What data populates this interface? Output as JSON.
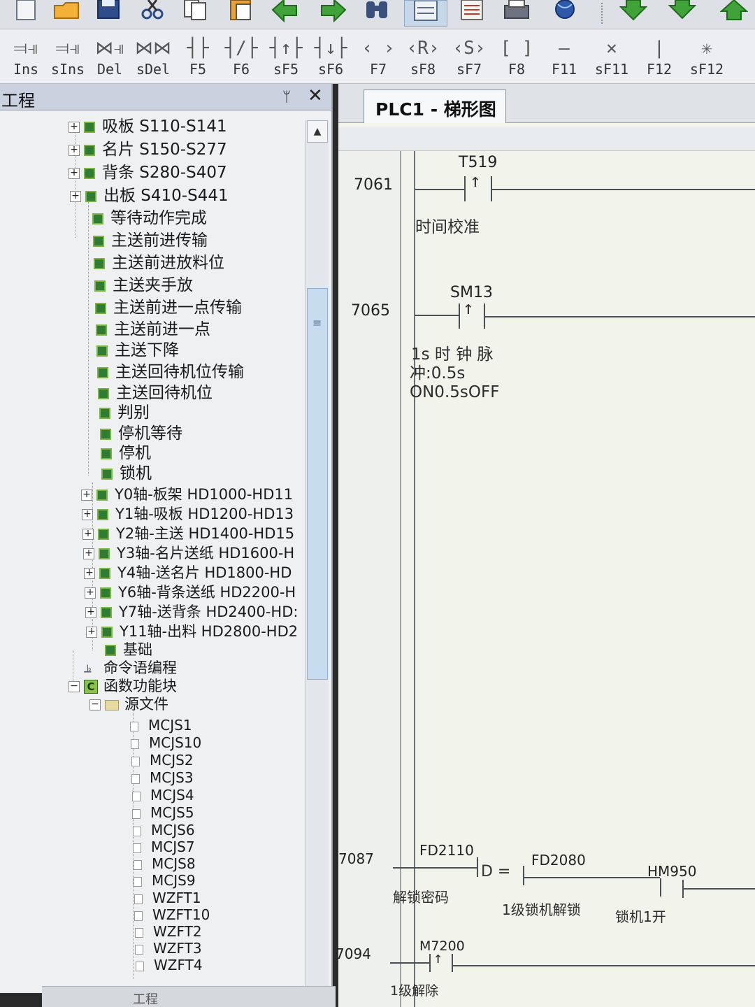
{
  "toolbar_keys": [
    {
      "sym": "⫤⫣",
      "key": "Ins"
    },
    {
      "sym": "⫤⫣",
      "key": "sIns"
    },
    {
      "sym": "⋈⫣",
      "key": "Del"
    },
    {
      "sym": "⋈⋈",
      "key": "sDel"
    },
    {
      "sym": "┤├",
      "key": "F5"
    },
    {
      "sym": "┤/├",
      "key": "F6"
    },
    {
      "sym": "┤↑├",
      "key": "sF5"
    },
    {
      "sym": "┤↓├",
      "key": "sF6"
    },
    {
      "sym": "‹ ›",
      "key": "F7"
    },
    {
      "sym": "‹R›",
      "key": "sF8"
    },
    {
      "sym": "‹S›",
      "key": "sF7"
    },
    {
      "sym": "[ ]",
      "key": "F8"
    },
    {
      "sym": "—",
      "key": "F11"
    },
    {
      "sym": "✕",
      "key": "sF11"
    },
    {
      "sym": "|",
      "key": "F12"
    },
    {
      "sym": "✳",
      "key": "sF12"
    }
  ],
  "project_pane": {
    "title": "工程",
    "pin": "ᛘ",
    "close": "✕",
    "tree": [
      {
        "label": "吸板 S110-S141",
        "kind": "expand"
      },
      {
        "label": "名片 S150-S277",
        "kind": "expand"
      },
      {
        "label": "背条 S280-S407",
        "kind": "expand"
      },
      {
        "label": "出板 S410-S441",
        "kind": "expand"
      },
      {
        "label": "等待动作完成",
        "kind": "leaf"
      },
      {
        "label": "主送前进传输",
        "kind": "leaf"
      },
      {
        "label": "主送前进放料位",
        "kind": "leaf"
      },
      {
        "label": "主送夹手放",
        "kind": "leaf"
      },
      {
        "label": "主送前进一点传输",
        "kind": "leaf"
      },
      {
        "label": "主送前进一点",
        "kind": "leaf"
      },
      {
        "label": "主送下降",
        "kind": "leaf"
      },
      {
        "label": "主送回待机位传输",
        "kind": "leaf"
      },
      {
        "label": "主送回待机位",
        "kind": "leaf"
      },
      {
        "label": "判别",
        "kind": "leaf"
      },
      {
        "label": "停机等待",
        "kind": "leaf"
      },
      {
        "label": "停机",
        "kind": "leaf"
      },
      {
        "label": "锁机",
        "kind": "leaf"
      },
      {
        "label": "Y0轴-板架 HD1000-HD11",
        "kind": "expand"
      },
      {
        "label": "Y1轴-吸板 HD1200-HD13",
        "kind": "expand"
      },
      {
        "label": "Y2轴-主送 HD1400-HD15",
        "kind": "expand"
      },
      {
        "label": "Y3轴-名片送纸 HD1600-H",
        "kind": "expand"
      },
      {
        "label": "Y4轴-送名片 HD1800-HD",
        "kind": "expand"
      },
      {
        "label": "Y6轴-背条送纸 HD2200-H",
        "kind": "expand"
      },
      {
        "label": "Y7轴-送背条 HD2400-HD:",
        "kind": "expand"
      },
      {
        "label": "Y11轴-出料 HD2800-HD2",
        "kind": "expand"
      },
      {
        "label": "基础",
        "kind": "leaf"
      }
    ],
    "command_prog": "命令语编程",
    "func_block": "函数功能块",
    "c_badge": "C",
    "source_folder": "源文件",
    "files": [
      "MCJS1",
      "MCJS10",
      "MCJS2",
      "MCJS3",
      "MCJS4",
      "MCJS5",
      "MCJS6",
      "MCJS7",
      "MCJS8",
      "MCJS9",
      "WZFT1",
      "WZFT10",
      "WZFT2",
      "WZFT3",
      "WZFT4"
    ],
    "bottom_tab": "工程"
  },
  "editor": {
    "tab_title": "PLC1 - 梯形图",
    "rungs": {
      "r1": {
        "step": "7061",
        "contact": "T519",
        "comment": "时间校准"
      },
      "r2": {
        "step": "7065",
        "contact": "SM13",
        "comment_l1": "1s 时 钟 脉",
        "comment_l2": "冲:0.5s",
        "comment_l3": "ON0.5sOFF"
      },
      "r3": {
        "step": "7087",
        "c1": "FD2110",
        "op": "D =",
        "c2": "FD2080",
        "c3": "HM950",
        "cm1": "解锁密码",
        "cm2": "1级锁机解锁",
        "cm3": "锁机1开"
      },
      "r4": {
        "step": "7094",
        "contact": "M7200",
        "comment": "1级解除"
      }
    }
  },
  "colors": {
    "rail": "#4a4f54",
    "tree_icon": "#2e7d32",
    "tab_bg": "#f7f8fa"
  }
}
